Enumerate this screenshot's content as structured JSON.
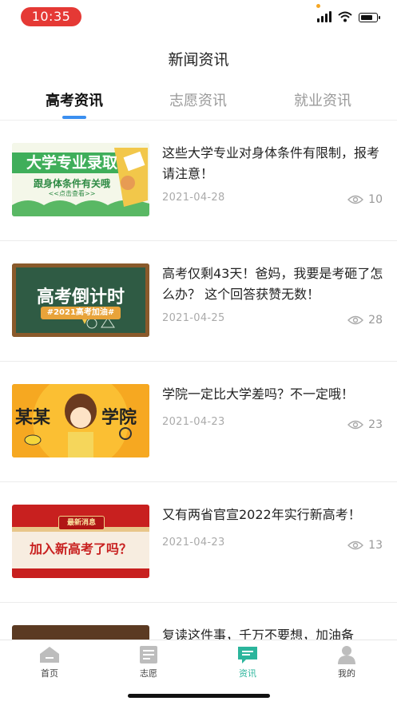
{
  "status_bar": {
    "time": "10:35"
  },
  "header": {
    "title": "新闻资讯"
  },
  "tabs": [
    {
      "label": "高考资讯",
      "active": true
    },
    {
      "label": "志愿资讯",
      "active": false
    },
    {
      "label": "就业资讯",
      "active": false
    }
  ],
  "news": [
    {
      "title": "这些大学专业对身体条件有限制，报考请注意！",
      "date": "2021-04-28",
      "views": "10",
      "thumb": {
        "line1": "大学专业录取",
        "line2": "跟身体条件有关哦",
        "line3": "<<点击查看>>"
      }
    },
    {
      "title": "高考仅剩43天！爸妈，我要是考砸了怎么办？ 这个回答获赞无数！",
      "date": "2021-04-25",
      "views": "28",
      "thumb": {
        "line1": "高考倒计时",
        "line2": "#2021高考加油#"
      }
    },
    {
      "title": "学院一定比大学差吗？不一定哦！",
      "date": "2021-04-23",
      "views": "23",
      "thumb": {
        "line1": "某某",
        "line2": "学院"
      }
    },
    {
      "title": "又有两省官宣2022年实行新高考！",
      "date": "2021-04-23",
      "views": "13",
      "thumb": {
        "line1": "最新消息",
        "line2": "加入新高考了吗？"
      }
    },
    {
      "title": "复读这件事，千万不要想，加油备",
      "date": "",
      "views": "",
      "thumb": {}
    }
  ],
  "bottom_nav": [
    {
      "label": "首页",
      "icon": "home-icon",
      "active": false
    },
    {
      "label": "志愿",
      "icon": "document-icon",
      "active": false
    },
    {
      "label": "资讯",
      "icon": "message-icon",
      "active": true
    },
    {
      "label": "我的",
      "icon": "profile-icon",
      "active": false
    }
  ],
  "colors": {
    "accent_tab": "#3a8ff0",
    "accent_nav": "#2bb59c",
    "status_time_bg": "#e53935"
  }
}
